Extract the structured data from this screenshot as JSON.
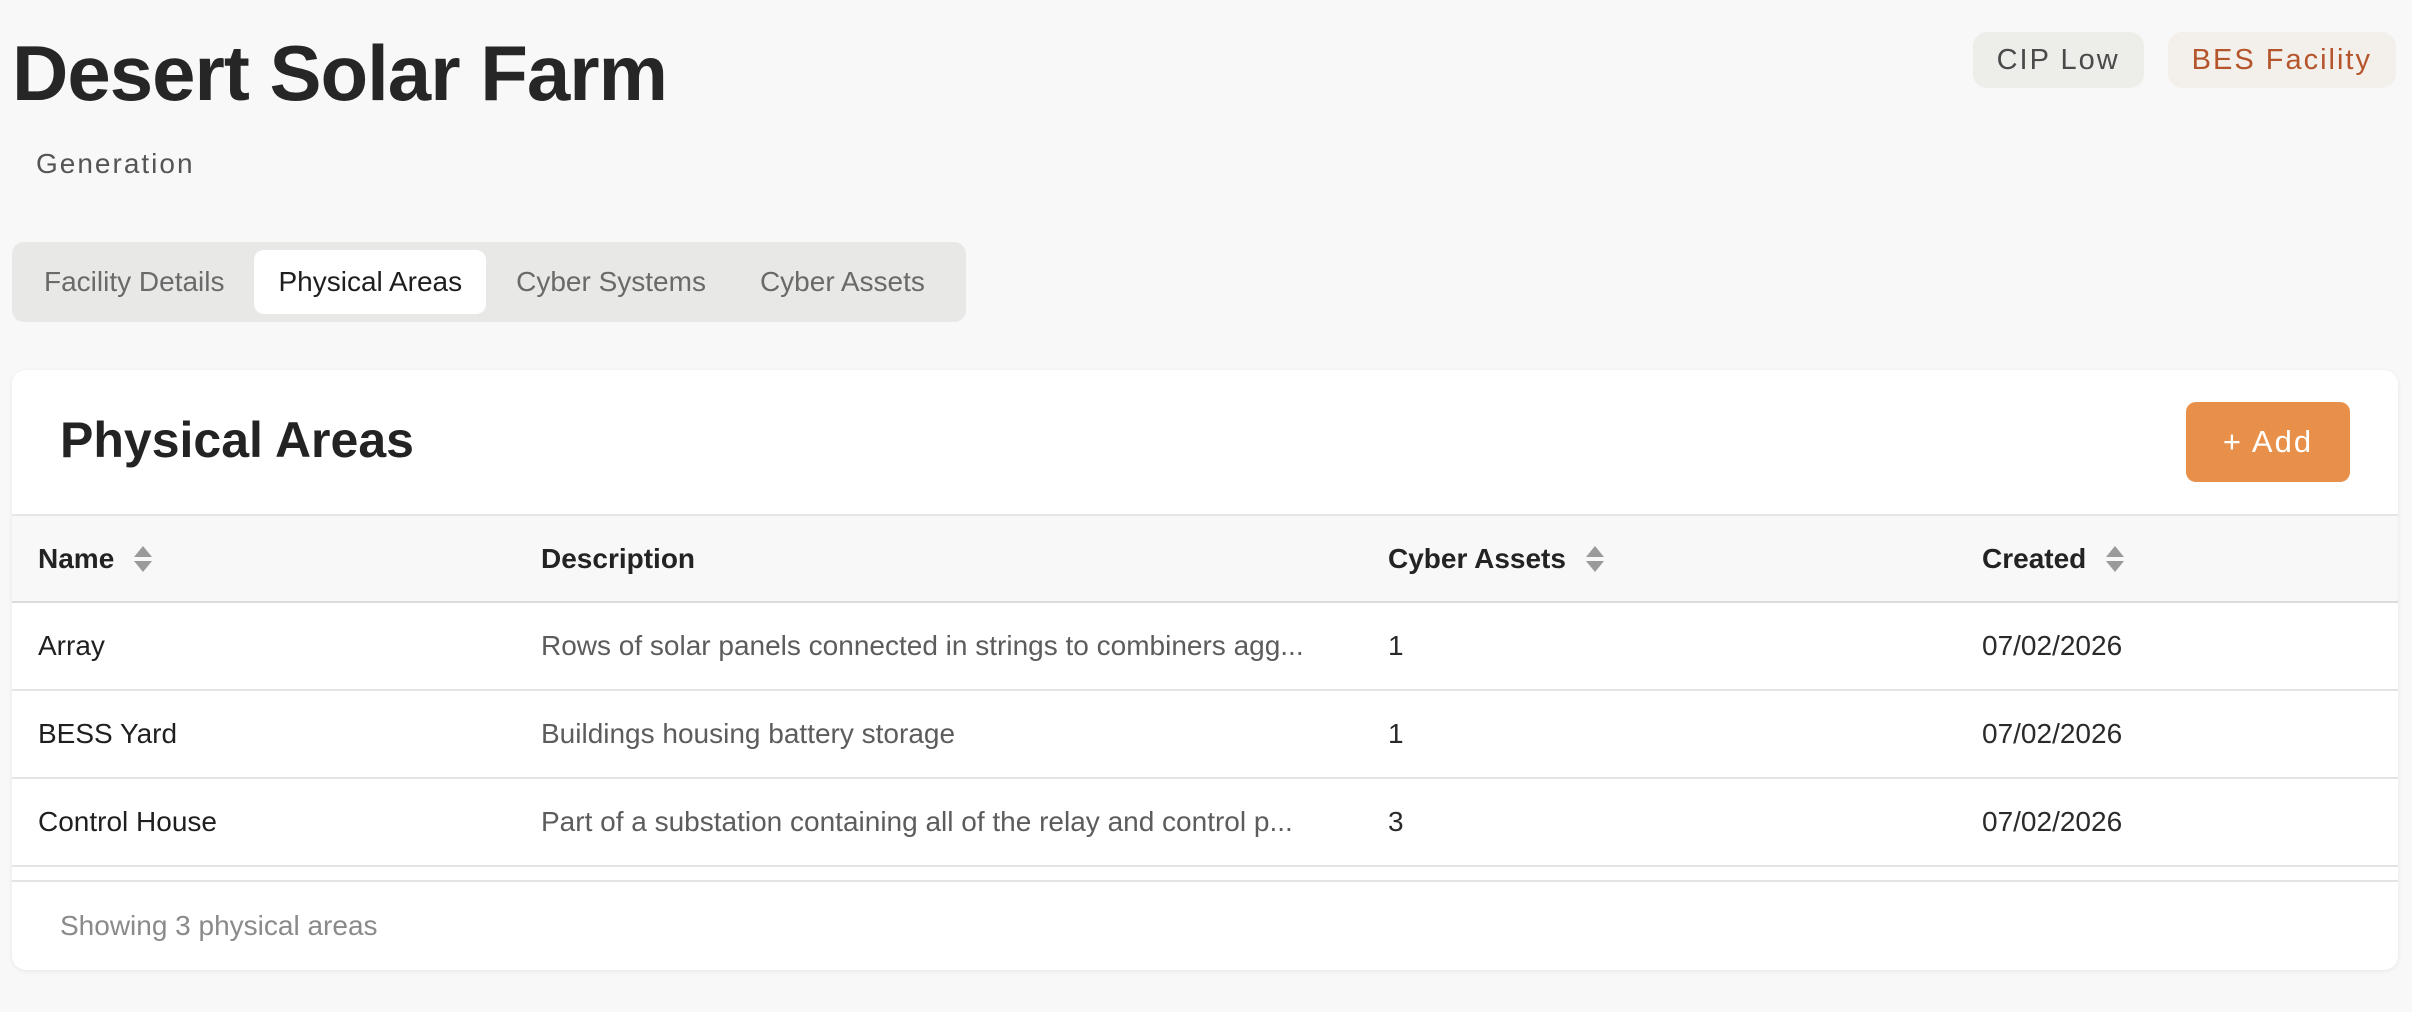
{
  "header": {
    "title": "Desert Solar Farm",
    "subtitle": "Generation",
    "badges": {
      "cip": "CIP Low",
      "bes": "BES Facility"
    }
  },
  "tabs": [
    {
      "label": "Facility Details",
      "active": false
    },
    {
      "label": "Physical Areas",
      "active": true
    },
    {
      "label": "Cyber Systems",
      "active": false
    },
    {
      "label": "Cyber Assets",
      "active": false
    }
  ],
  "card": {
    "title": "Physical Areas",
    "add_label": "+ Add",
    "columns": {
      "name": "Name",
      "description": "Description",
      "cyber_assets": "Cyber Assets",
      "created": "Created"
    },
    "rows": [
      {
        "name": "Array",
        "description": "Rows of solar panels connected in strings to combiners agg...",
        "cyber_assets": "1",
        "created": "07/02/2026"
      },
      {
        "name": "BESS Yard",
        "description": "Buildings housing battery storage",
        "cyber_assets": "1",
        "created": "07/02/2026"
      },
      {
        "name": "Control House",
        "description": "Part of a substation containing all of the relay and control p...",
        "cyber_assets": "3",
        "created": "07/02/2026"
      }
    ],
    "footer": "Showing 3 physical areas"
  },
  "colors": {
    "accent": "#e8904a",
    "bes_badge_text": "#b5552b",
    "background": "#f7f8f7"
  },
  "icons": {
    "sort": "sort-icon"
  }
}
